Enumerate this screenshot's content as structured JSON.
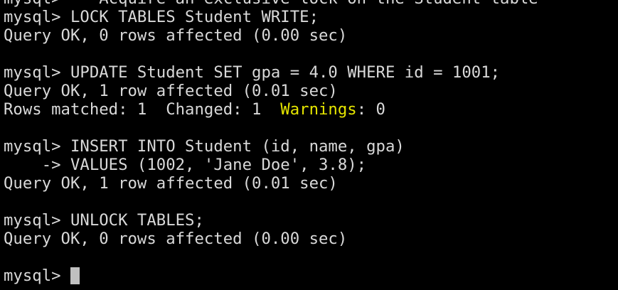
{
  "terminal": {
    "lines": [
      "mysql> -- Acquire an exclusive lock on the Student table",
      "mysql> LOCK TABLES Student WRITE;",
      "Query OK, 0 rows affected (0.00 sec)",
      "",
      "mysql> UPDATE Student SET gpa = 4.0 WHERE id = 1001;",
      "Query OK, 1 row affected (0.01 sec)",
      "Rows matched: 1  Changed: 1  ",
      "",
      "mysql> INSERT INTO Student (id, name, gpa)",
      "    -> VALUES (1002, 'Jane Doe', 3.8);",
      "Query OK, 1 row affected (0.01 sec)",
      "",
      "mysql> UNLOCK TABLES;",
      "Query OK, 0 rows affected (0.00 sec)",
      "",
      "mysql> "
    ],
    "warnings_label": "Warnings",
    "warnings_value": ": 0",
    "colors": {
      "background": "#000000",
      "text": "#d9d9d9",
      "warning": "#e6e600",
      "cursor": "#c0c0c0"
    }
  }
}
